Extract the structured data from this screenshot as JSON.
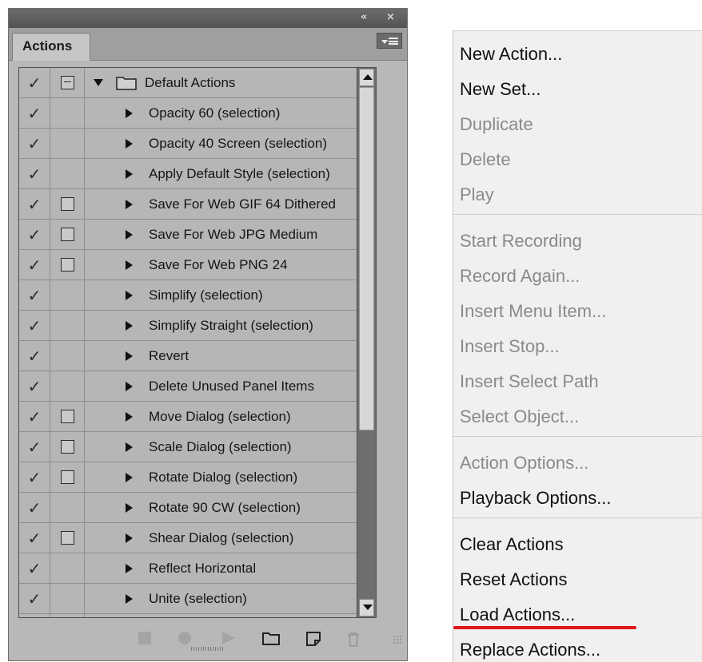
{
  "panel": {
    "tab_label": "Actions",
    "collapse_glyph": "«",
    "close_glyph": "×",
    "check_glyph": "✓",
    "rows": [
      {
        "label": "Default Actions",
        "type": "set",
        "checked": true,
        "dialog": "partial"
      },
      {
        "label": "Opacity 60 (selection)",
        "type": "action",
        "checked": true,
        "dialog": "none"
      },
      {
        "label": "Opacity 40 Screen (selection)",
        "type": "action",
        "checked": true,
        "dialog": "none"
      },
      {
        "label": "Apply Default Style (selection)",
        "type": "action",
        "checked": true,
        "dialog": "none"
      },
      {
        "label": "Save For Web GIF 64 Dithered",
        "type": "action",
        "checked": true,
        "dialog": "on"
      },
      {
        "label": "Save For Web JPG Medium",
        "type": "action",
        "checked": true,
        "dialog": "on"
      },
      {
        "label": "Save For Web PNG 24",
        "type": "action",
        "checked": true,
        "dialog": "on"
      },
      {
        "label": "Simplify (selection)",
        "type": "action",
        "checked": true,
        "dialog": "none"
      },
      {
        "label": "Simplify Straight (selection)",
        "type": "action",
        "checked": true,
        "dialog": "none"
      },
      {
        "label": "Revert",
        "type": "action",
        "checked": true,
        "dialog": "none"
      },
      {
        "label": "Delete Unused Panel Items",
        "type": "action",
        "checked": true,
        "dialog": "none"
      },
      {
        "label": "Move Dialog (selection)",
        "type": "action",
        "checked": true,
        "dialog": "on"
      },
      {
        "label": "Scale Dialog (selection)",
        "type": "action",
        "checked": true,
        "dialog": "on"
      },
      {
        "label": "Rotate Dialog (selection)",
        "type": "action",
        "checked": true,
        "dialog": "on"
      },
      {
        "label": "Rotate 90 CW (selection)",
        "type": "action",
        "checked": true,
        "dialog": "none"
      },
      {
        "label": "Shear Dialog (selection)",
        "type": "action",
        "checked": true,
        "dialog": "on"
      },
      {
        "label": "Reflect Horizontal",
        "type": "action",
        "checked": true,
        "dialog": "none"
      },
      {
        "label": "Unite (selection)",
        "type": "action",
        "checked": true,
        "dialog": "none"
      },
      {
        "label": "",
        "type": "action",
        "checked": true,
        "dialog": "none"
      }
    ],
    "bottom_buttons": [
      "stop-icon",
      "record-icon",
      "play-icon",
      "new-set-folder-icon",
      "new-action-icon",
      "trash-icon"
    ]
  },
  "menu": {
    "groups": [
      [
        {
          "label": "New Action...",
          "enabled": true
        },
        {
          "label": "New Set...",
          "enabled": true
        },
        {
          "label": "Duplicate",
          "enabled": false
        },
        {
          "label": "Delete",
          "enabled": false
        },
        {
          "label": "Play",
          "enabled": false
        }
      ],
      [
        {
          "label": "Start Recording",
          "enabled": false
        },
        {
          "label": "Record Again...",
          "enabled": false
        },
        {
          "label": "Insert Menu Item...",
          "enabled": false
        },
        {
          "label": "Insert Stop...",
          "enabled": false
        },
        {
          "label": "Insert Select Path",
          "enabled": false
        },
        {
          "label": "Select Object...",
          "enabled": false
        }
      ],
      [
        {
          "label": "Action Options...",
          "enabled": false
        },
        {
          "label": "Playback Options...",
          "enabled": true
        }
      ],
      [
        {
          "label": "Clear Actions",
          "enabled": true
        },
        {
          "label": "Reset Actions",
          "enabled": true
        },
        {
          "label": "Load Actions...",
          "enabled": true,
          "highlighted": true
        },
        {
          "label": "Replace Actions...",
          "enabled": true
        }
      ]
    ],
    "highlight_color": "#e3141a"
  }
}
